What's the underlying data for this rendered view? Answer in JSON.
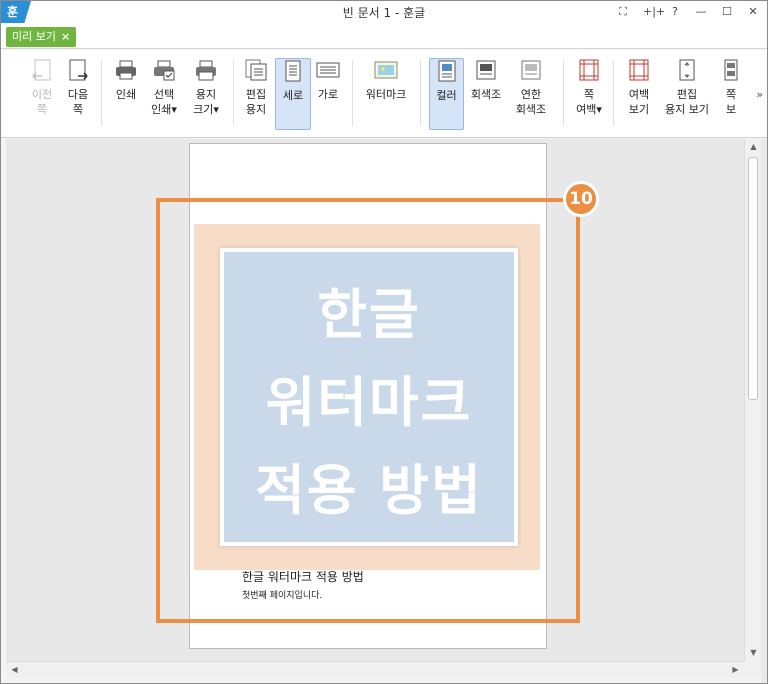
{
  "app": {
    "logo": "훈",
    "title": "빈 문서 1 - 훈글"
  },
  "title_buttons": [
    "⛶",
    "+|+",
    "?",
    "—",
    "☐",
    "✕"
  ],
  "tab": {
    "label": "미리 보기",
    "close": "×"
  },
  "ribbon": {
    "prev_page": [
      "이전",
      "쪽"
    ],
    "next_page": [
      "다음",
      "쪽"
    ],
    "print": [
      "인쇄"
    ],
    "select_print": [
      "선택",
      "인쇄▾"
    ],
    "paper_size": [
      "용지",
      "크기▾"
    ],
    "edit_paper": [
      "편집",
      "용지"
    ],
    "portrait": [
      "세로"
    ],
    "landscape": [
      "가로"
    ],
    "watermark": [
      "워터마크"
    ],
    "color": [
      "컬러"
    ],
    "grayscale": [
      "회색조"
    ],
    "light_grayscale": [
      "연한",
      "회색조"
    ],
    "page_margin": [
      "쪽",
      "여백▾"
    ],
    "margin_view": [
      "여백",
      "보기"
    ],
    "edit_paper_view": [
      "편집",
      "용지 보기"
    ],
    "cutoff": [
      "쪽",
      "보"
    ],
    "more": "»"
  },
  "document": {
    "watermark_lines": [
      "한글",
      "워터마크",
      "적용 방법"
    ],
    "title": "한글 워터마크 적용 방법",
    "body": "첫번째 페이지입니다."
  },
  "callout": {
    "number": "10",
    "color": "#ec8f45"
  },
  "accent": {
    "tab_green": "#6fb53f",
    "active_blue": "#d6e4f7"
  }
}
